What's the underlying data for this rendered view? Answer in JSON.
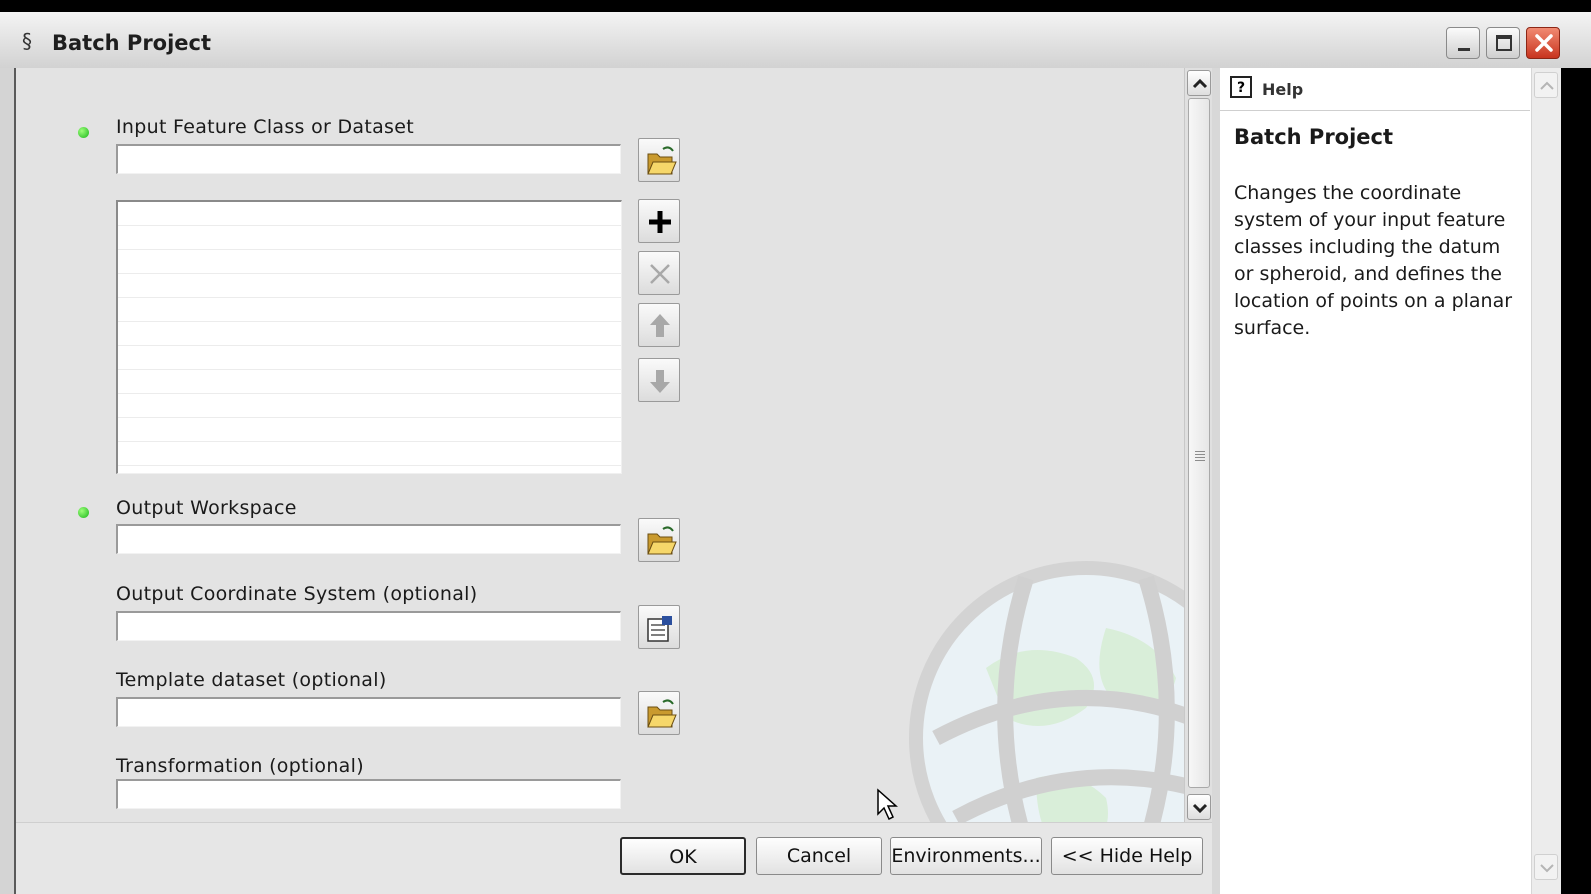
{
  "window": {
    "title": "Batch Project",
    "controls": [
      "minimize-icon",
      "maximize-icon",
      "close-icon"
    ]
  },
  "form": {
    "parameters": [
      {
        "key": "input",
        "label": "Input Feature Class or Dataset",
        "required": true,
        "value": "",
        "button": "folder-open-icon"
      },
      {
        "key": "output_workspace",
        "label": "Output Workspace",
        "required": true,
        "value": "",
        "button": "folder-open-icon"
      },
      {
        "key": "output_cs",
        "label": "Output Coordinate System (optional)",
        "required": false,
        "value": "",
        "button": "properties-icon"
      },
      {
        "key": "template",
        "label": "Template dataset (optional)",
        "required": false,
        "value": "",
        "button": "folder-open-icon"
      },
      {
        "key": "transformation",
        "label": "Transformation (optional)",
        "required": false,
        "value": ""
      }
    ],
    "list_buttons": [
      "add-icon",
      "remove-icon",
      "move-up-icon",
      "move-down-icon"
    ],
    "list_rows": [
      "",
      "",
      "",
      "",
      "",
      "",
      "",
      "",
      "",
      "",
      ""
    ]
  },
  "footer": {
    "ok": "OK",
    "cancel": "Cancel",
    "environments": "Environments...",
    "hide_help": "<< Hide Help"
  },
  "help": {
    "tab_label": "Help",
    "title": "Batch Project",
    "body": "Changes the coordinate system of your input feature classes including the datum or spheroid, and defines the location of points on a planar surface."
  },
  "colors": {
    "required_dot": "#19b51a",
    "close_button": "#c8341e",
    "dialog_background": "#e3e3e3"
  }
}
